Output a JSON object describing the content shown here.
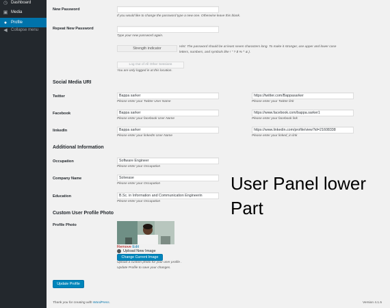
{
  "sidebar": {
    "items": [
      {
        "label": "Dashboard",
        "icon": "dashboard-icon"
      },
      {
        "label": "Media",
        "icon": "media-icon"
      },
      {
        "label": "Profile",
        "icon": "user-icon"
      },
      {
        "label": "Collapse menu",
        "icon": "collapse-icon"
      }
    ]
  },
  "form": {
    "new_password": {
      "label": "New Password",
      "value": "",
      "desc": "If you would like to change the password type a new one. Otherwise leave this blank."
    },
    "repeat_password": {
      "label": "Repeat New Password",
      "value": "",
      "desc": "Type your new password again."
    },
    "strength": {
      "label": "Strength indicator",
      "hint": "Hint: The password should be at least seven characters long. To make it stronger, use upper and lower case",
      "hint2": "letters, numbers, and symbols like ! \" ? $ % ^ & )."
    },
    "sessions": {
      "button": "Log Out of All Other Sessions",
      "desc": "You are only logged in at this location."
    },
    "social_title": "Social Media URI",
    "twitter": {
      "label": "Twitter",
      "name": "Bappa sarker",
      "name_desc": "Please enter your Twitter User Name",
      "url": "https://twitter.com/Bappasarker",
      "url_desc": "Please enter your Twitter link"
    },
    "facebook": {
      "label": "Facebook",
      "name": "Bappa sarker",
      "name_desc": "Please enter your facebook User Name",
      "url": "https://www.facebook.com/bappa.sarker1",
      "url_desc": "Please enter your facebook link"
    },
    "linkedin": {
      "label": "linkedIn",
      "name": "Bappa sarker",
      "name_desc": "Please enter your linkedIn User Name",
      "url": "https://www.linkedin.com/profile/view?id=21608338",
      "url_desc": "Please enter your linked_in link"
    },
    "additional_title": "Additional Information",
    "occupation": {
      "label": "Occupation",
      "value": "Software Engineer",
      "desc": "Please enter your Occupation"
    },
    "company": {
      "label": "Company Name",
      "value": "Solvease",
      "desc": "Please enter your Occupation"
    },
    "education": {
      "label": "Education",
      "value": "B.Sc. in Information and Communication Engineerin",
      "desc": "Please enter your Occupation"
    },
    "custom_photo_title": "Custom User Profile Photo",
    "profile_photo": {
      "label": "Profile Photo",
      "remove": "Remove",
      "edit": "Edit",
      "upload": "Upload New Image",
      "change": "Change Current Image",
      "desc1": "Upload a custom photo for your user profile .",
      "desc2": "Update Profile to save your changes."
    },
    "update_button": "Update Profile"
  },
  "overlay_text": {
    "line1": "User Panel lower",
    "line2": "Part"
  },
  "footer": {
    "thanks_prefix": "Thank you for creating with ",
    "thanks_link": "WordPress",
    "thanks_suffix": ".",
    "version": "Version 4.1.5"
  },
  "colors": {
    "sidebar_bg": "#23282d",
    "accent": "#0073aa",
    "button_primary": "#0085ba"
  }
}
